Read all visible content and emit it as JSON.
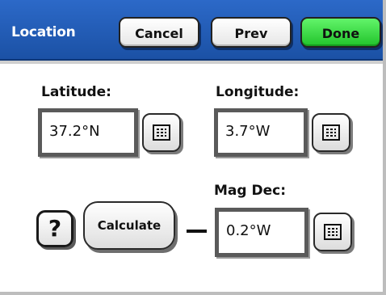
{
  "header": {
    "title": "Location",
    "cancel_label": "Cancel",
    "prev_label": "Prev",
    "done_label": "Done",
    "bar_color": "#1f5bb8",
    "done_color": "#2bd335"
  },
  "latitude": {
    "label": "Latitude:",
    "value": "37.2°N",
    "keypad_icon": "keypad-icon"
  },
  "longitude": {
    "label": "Longitude:",
    "value": "3.7°W",
    "keypad_icon": "keypad-icon"
  },
  "mag_dec": {
    "label": "Mag Dec:",
    "value": "0.2°W",
    "keypad_icon": "keypad-icon"
  },
  "actions": {
    "help_label": "?",
    "calculate_label": "Calculate"
  }
}
